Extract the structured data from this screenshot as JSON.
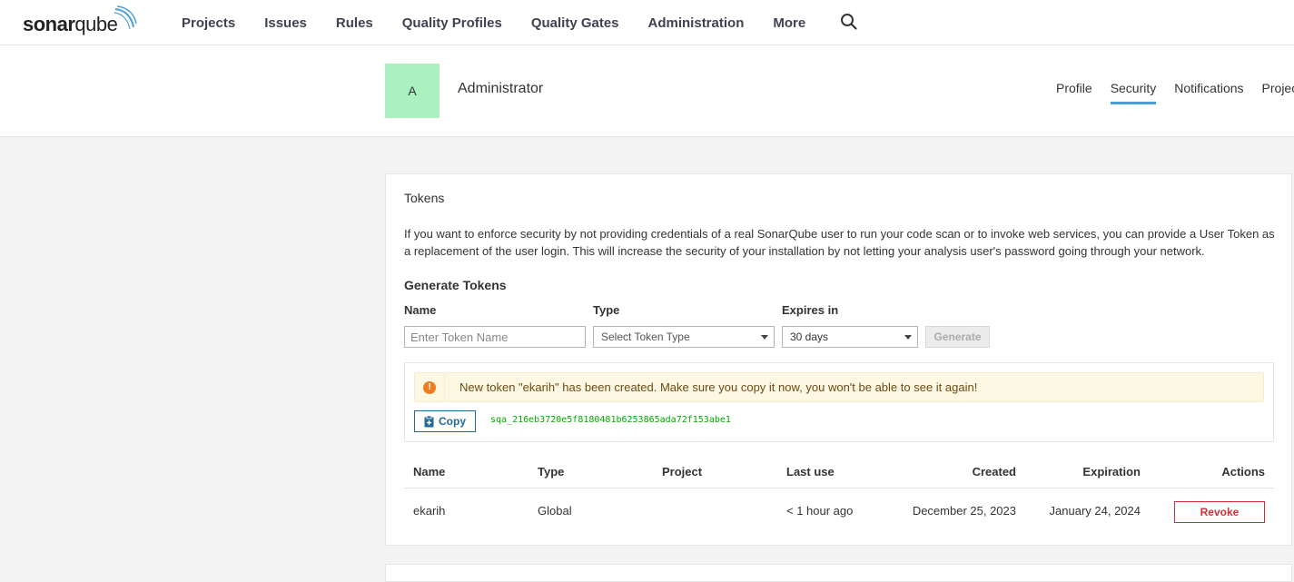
{
  "brand": {
    "bold": "sonar",
    "light": "qube"
  },
  "nav": {
    "items": [
      "Projects",
      "Issues",
      "Rules",
      "Quality Profiles",
      "Quality Gates",
      "Administration",
      "More"
    ],
    "search_icon": "search-icon"
  },
  "account": {
    "avatar_letter": "A",
    "avatar_color": "#aaf0c0",
    "name": "Administrator",
    "tabs": [
      {
        "label": "Profile",
        "active": false
      },
      {
        "label": "Security",
        "active": true
      },
      {
        "label": "Notifications",
        "active": false
      },
      {
        "label": "Projects",
        "active": false
      }
    ]
  },
  "tokens": {
    "title": "Tokens",
    "description": "If you want to enforce security by not providing credentials of a real SonarQube user to run your code scan or to invoke web services, you can provide a User Token as a replacement of the user login. This will increase the security of your installation by not letting your analysis user's password going through your network.",
    "generate_title": "Generate Tokens",
    "form": {
      "name_label": "Name",
      "name_placeholder": "Enter Token Name",
      "name_value": "",
      "type_label": "Type",
      "type_placeholder": "Select Token Type",
      "expires_label": "Expires in",
      "expires_value": "30 days",
      "generate_label": "Generate"
    },
    "alert": {
      "icon": "warning-icon",
      "text": "New token \"ekarih\" has been created. Make sure you copy it now, you won't be able to see it again!"
    },
    "copy_label": "Copy",
    "token_value": "sqa_216eb3720e5f8180481b6253865ada72f153abe1",
    "table": {
      "headers": [
        "Name",
        "Type",
        "Project",
        "Last use",
        "Created",
        "Expiration",
        "Actions"
      ],
      "rows": [
        {
          "name": "ekarih",
          "type": "Global",
          "project": "",
          "last_use": "< 1 hour ago",
          "created": "December 25, 2023",
          "expiration": "January 24, 2024",
          "action": "Revoke"
        }
      ]
    }
  }
}
